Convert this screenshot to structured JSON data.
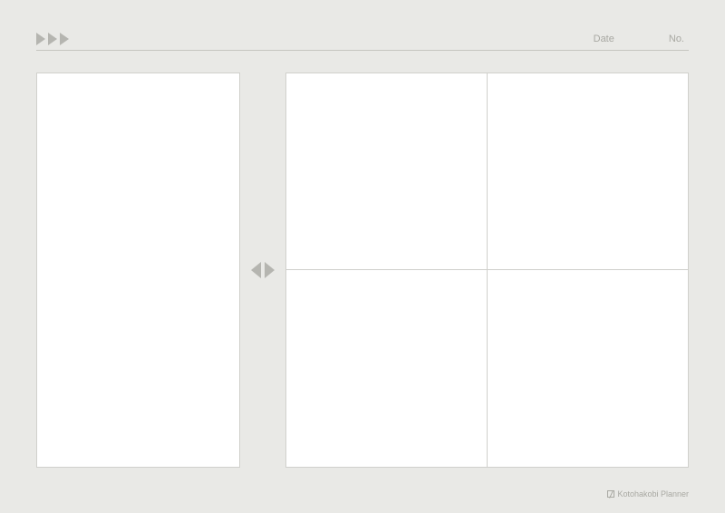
{
  "header": {
    "date_label": "Date",
    "no_label": "No."
  },
  "footer": {
    "brand": "Kotohakobi Planner"
  }
}
